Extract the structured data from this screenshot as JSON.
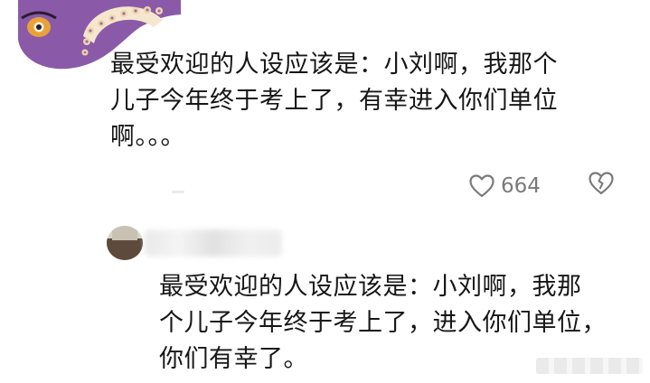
{
  "comment1": {
    "lines": [
      "最受欢迎的人设应该是：小刘啊，我那个",
      "儿子今年终于考上了，有幸进入你们单位",
      "啊。。。"
    ],
    "likes": "664"
  },
  "comment2": {
    "lines": [
      "最受欢迎的人设应该是：小刘啊，我那",
      "个儿子今年终于考上了，进入你们单位，",
      "你们有幸了。"
    ]
  },
  "icons": {
    "like": "heart-outline-icon",
    "dislike": "broken-heart-icon"
  },
  "colors": {
    "avatar_purple": "#8a5aa8",
    "avatar_orange": "#e9a23a",
    "text": "#161616",
    "meta": "#7a7a7a"
  }
}
